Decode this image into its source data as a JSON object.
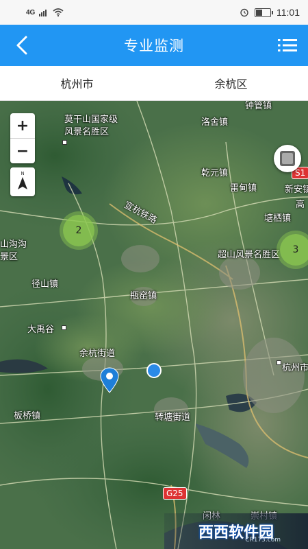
{
  "status_bar": {
    "signal": "4G",
    "time": "11:01"
  },
  "header": {
    "title": "专业监测"
  },
  "selectors": {
    "city": "杭州市",
    "district": "余杭区"
  },
  "map": {
    "labels": {
      "moganshan": "莫干山国家级",
      "moganshan2": "风景名胜区",
      "luoshe": "洛舍镇",
      "qianyuan": "乾元镇",
      "leidian": "雷甸镇",
      "xinan": "新安镇",
      "gaohong": "高",
      "xuanhang": "宣杭铁路",
      "tangqi": "塘栖镇",
      "chaoshan": "超山风景名胜区",
      "shangou": "山沟沟",
      "qu": "景区",
      "jingshan": "径山镇",
      "pingyao": "瓶窑镇",
      "dayugu": "大禹谷",
      "yuhang": "余杭街道",
      "hangzhou": "杭州市",
      "banqiao": "板桥镇",
      "zhuantang": "转塘街道",
      "g25": "G25",
      "s": "S1",
      "zhonggu": "钟管镇",
      "bottom1": "闲林",
      "bottom2": "崇村镇"
    },
    "clusters": [
      {
        "count": "2"
      },
      {
        "count": "3"
      }
    ],
    "zoom_in": "+",
    "zoom_out": "−",
    "compass_label": "N"
  },
  "watermark": {
    "text": "西西软件园",
    "sub": "CR173.com"
  }
}
